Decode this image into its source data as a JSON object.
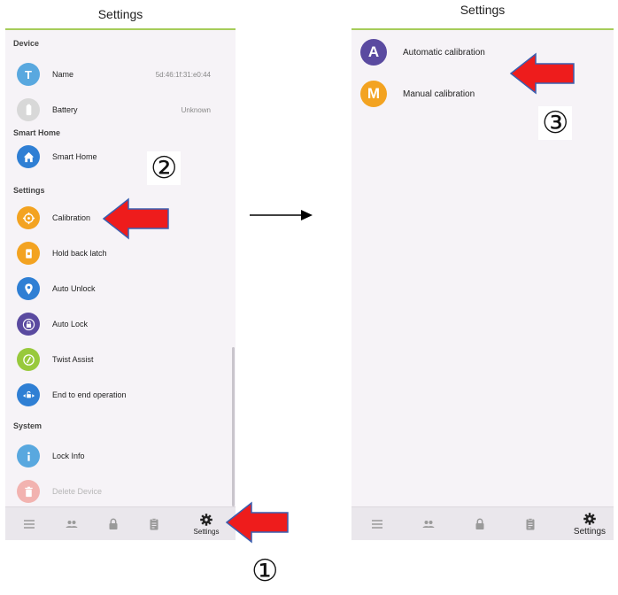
{
  "left": {
    "title": "Settings",
    "sections": {
      "device": "Device",
      "smart_home": "Smart Home",
      "settings": "Settings",
      "system": "System"
    },
    "items": {
      "name": {
        "label": "Name",
        "value": "5d:46:1f:31:e0:44",
        "icon": "T",
        "color": "#59a8df"
      },
      "battery": {
        "label": "Battery",
        "value": "Unknown",
        "color": "#d8d8d8"
      },
      "smart_home": {
        "label": "Smart Home",
        "color": "#2f7fd4"
      },
      "calibration": {
        "label": "Calibration",
        "color": "#f3a321"
      },
      "hold_back_latch": {
        "label": "Hold back latch",
        "color": "#f3a321"
      },
      "auto_unlock": {
        "label": "Auto Unlock",
        "color": "#2f7fd4"
      },
      "auto_lock": {
        "label": "Auto Lock",
        "color": "#5a4aa0"
      },
      "twist_assist": {
        "label": "Twist Assist",
        "color": "#98c93c"
      },
      "end_to_end": {
        "label": "End to end operation",
        "color": "#2f7fd4"
      },
      "lock_info": {
        "label": "Lock Info",
        "color": "#59a8df"
      },
      "delete_device": {
        "label": "Delete Device",
        "color": "#f2b3b0"
      }
    },
    "nav": {
      "settings_label": "Settings"
    }
  },
  "right": {
    "title": "Settings",
    "items": {
      "automatic": {
        "label": "Automatic calibration",
        "letter": "A",
        "color": "#5a4aa0"
      },
      "manual": {
        "label": "Manual calibration",
        "letter": "M",
        "color": "#f3a321"
      }
    },
    "nav": {
      "settings_label": "Settings"
    }
  },
  "annotations": {
    "step1": "①",
    "step2": "②",
    "step3": "③"
  }
}
